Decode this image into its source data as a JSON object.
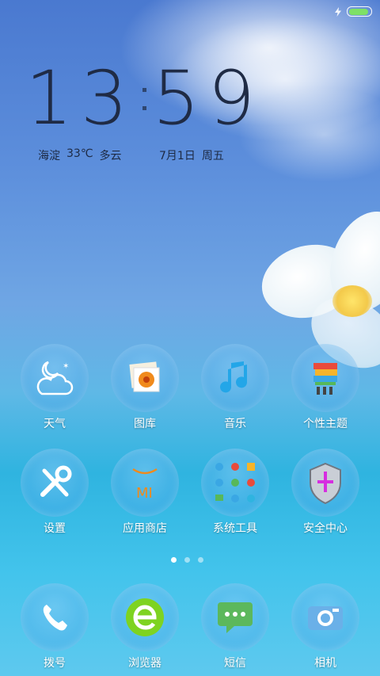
{
  "status": {
    "battery_level": 0.9,
    "charging": true
  },
  "clock": {
    "hours": "13",
    "minutes": "59"
  },
  "weather": {
    "location": "海淀",
    "temperature": "33℃",
    "condition": "多云"
  },
  "date": {
    "day": "7月1日",
    "weekday": "周五"
  },
  "apps_row1": [
    {
      "label": "天气",
      "icon": "weather-icon"
    },
    {
      "label": "图库",
      "icon": "gallery-icon"
    },
    {
      "label": "音乐",
      "icon": "music-icon"
    },
    {
      "label": "个性主题",
      "icon": "themes-icon"
    }
  ],
  "apps_row2": [
    {
      "label": "设置",
      "icon": "settings-icon"
    },
    {
      "label": "应用商店",
      "icon": "app-store-icon"
    },
    {
      "label": "系统工具",
      "icon": "system-tools-folder-icon"
    },
    {
      "label": "安全中心",
      "icon": "security-shield-icon"
    }
  ],
  "page_indicator": {
    "count": 3,
    "active": 1
  },
  "dock": [
    {
      "label": "拨号",
      "icon": "phone-icon"
    },
    {
      "label": "浏览器",
      "icon": "browser-icon"
    },
    {
      "label": "短信",
      "icon": "messages-icon"
    },
    {
      "label": "相机",
      "icon": "camera-icon"
    }
  ],
  "colors": {
    "clock": "#1f2b45",
    "battery": "#7ee067",
    "music": "#23a6e8"
  }
}
